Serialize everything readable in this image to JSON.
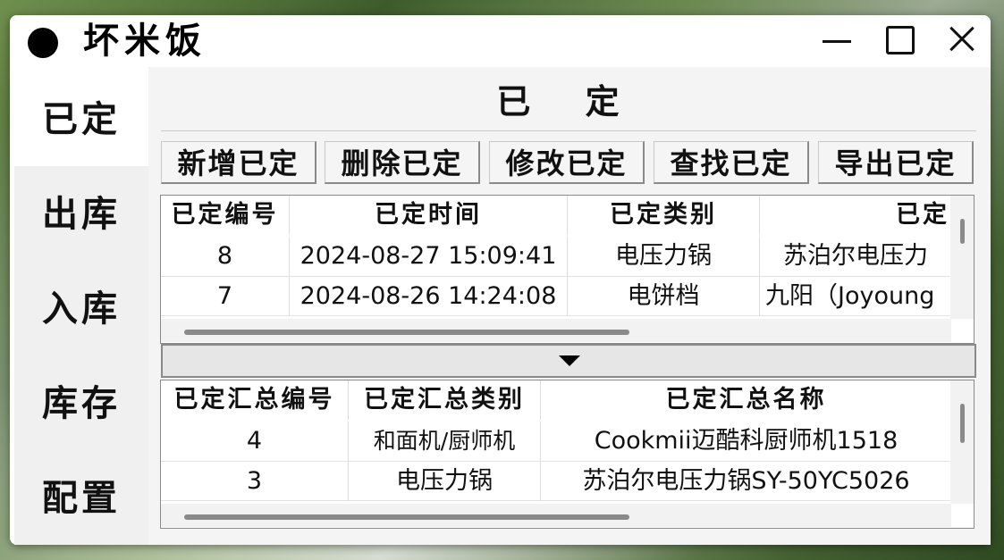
{
  "window": {
    "title": "坏米饭"
  },
  "sidebar": {
    "items": [
      {
        "label": "已定"
      },
      {
        "label": "出库"
      },
      {
        "label": "入库"
      },
      {
        "label": "库存"
      },
      {
        "label": "配置"
      }
    ]
  },
  "page": {
    "title": "已 定"
  },
  "toolbar": {
    "buttons": [
      {
        "label": "新增已定"
      },
      {
        "label": "删除已定"
      },
      {
        "label": "修改已定"
      },
      {
        "label": "查找已定"
      },
      {
        "label": "导出已定"
      }
    ]
  },
  "detail_table": {
    "columns": [
      "已定编号",
      "已定时间",
      "已定类别",
      "已定"
    ],
    "rows": [
      [
        "8",
        "2024-08-27 15:09:41",
        "电压力锅",
        "苏泊尔电压力"
      ],
      [
        "7",
        "2024-08-26 14:24:08",
        "电饼档",
        "九阳（Joyoung"
      ]
    ]
  },
  "summary_table": {
    "columns": [
      "已定汇总编号",
      "已定汇总类别",
      "已定汇总名称"
    ],
    "rows": [
      [
        "4",
        "和面机/厨师机",
        "Cookmii迈酷科厨师机1518"
      ],
      [
        "3",
        "电压力锅",
        "苏泊尔电压力锅SY-50YC5026"
      ]
    ]
  }
}
